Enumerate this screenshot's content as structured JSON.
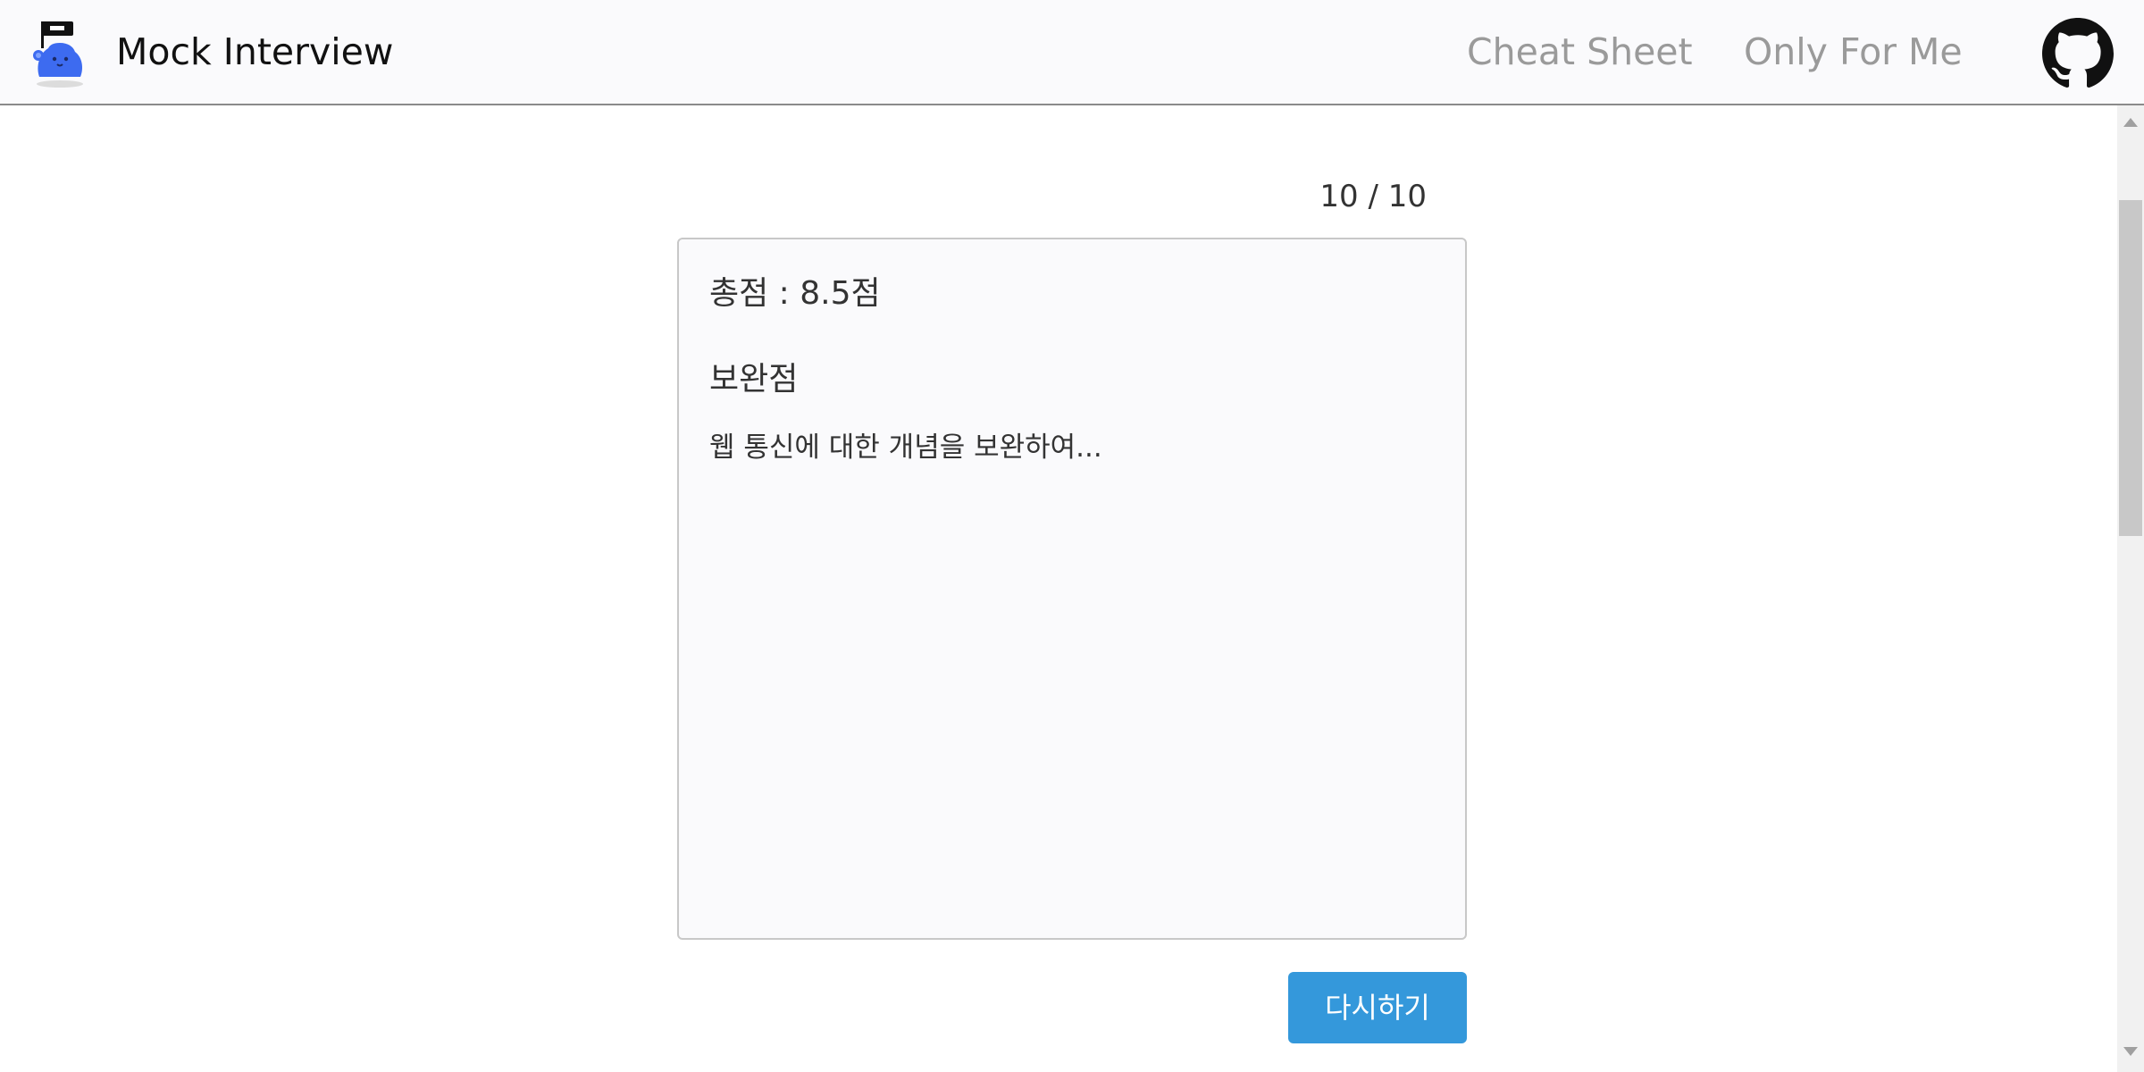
{
  "header": {
    "logo": "mascot-logo",
    "title": "Mock Interview",
    "nav": [
      {
        "label": "Cheat Sheet"
      },
      {
        "label": "Only For Me"
      }
    ],
    "github_icon": "github-icon"
  },
  "main": {
    "progress": "10 / 10",
    "result": {
      "score": "총점 : 8.5점",
      "improve_heading": "보완점",
      "improve_text": "웹 통신에 대한 개념을 보완하여..."
    },
    "retry_label": "다시하기"
  },
  "colors": {
    "accent": "#3498db",
    "header_bg": "#fafafc",
    "nav_text": "#9a9a9a"
  }
}
